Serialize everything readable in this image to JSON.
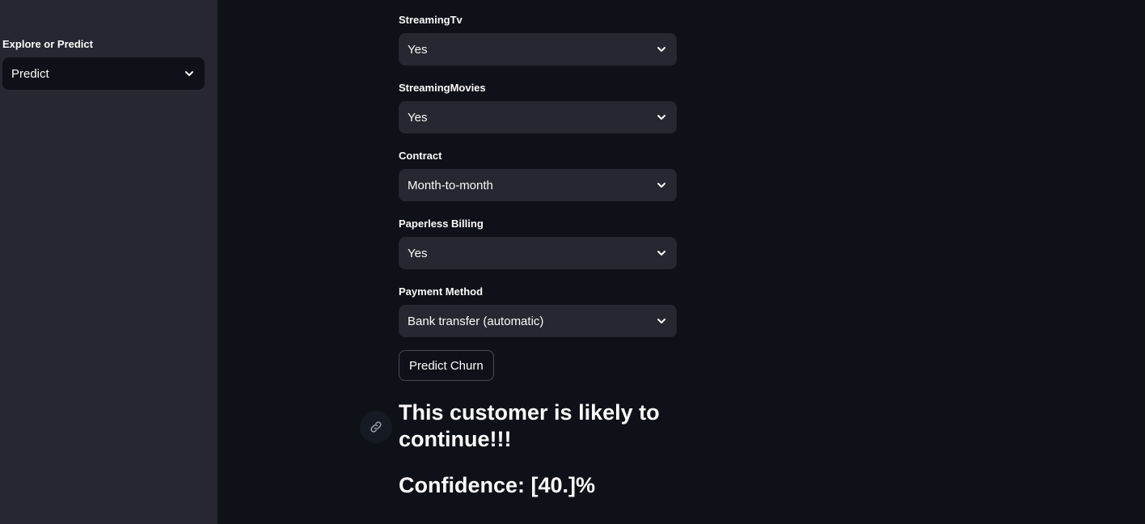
{
  "sidebar": {
    "label": "Explore or Predict",
    "selected": "Predict"
  },
  "fields": [
    {
      "label": "StreamingTv",
      "value": "Yes"
    },
    {
      "label": "StreamingMovies",
      "value": "Yes"
    },
    {
      "label": "Contract",
      "value": "Month-to-month"
    },
    {
      "label": "Paperless Billing",
      "value": "Yes"
    },
    {
      "label": "Payment Method",
      "value": "Bank transfer (automatic)"
    }
  ],
  "predict_button": "Predict Churn",
  "result": {
    "message": "This customer is likely to continue!!!",
    "confidence": "Confidence: [40.]%"
  },
  "icons": {
    "dropdown": "chevron-down-icon",
    "anchor": "link-icon"
  },
  "colors": {
    "background": "#0e1117",
    "sidebar": "#262730",
    "select_bg": "#262730",
    "text": "#fafafa"
  }
}
